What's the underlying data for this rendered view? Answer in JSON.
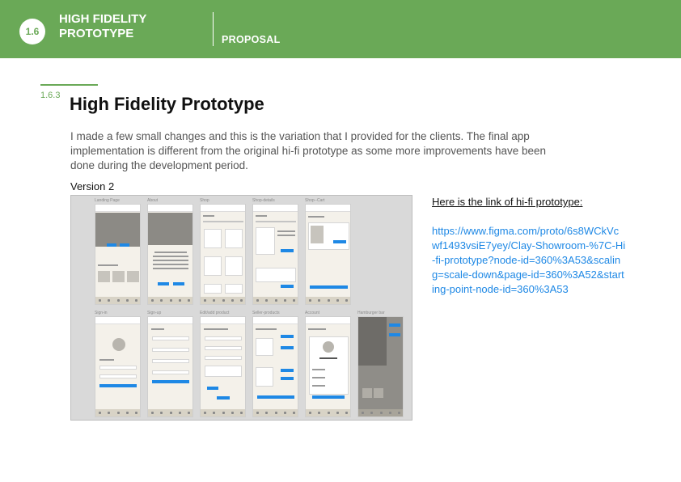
{
  "header": {
    "section_number": "1.6",
    "section_title": "HIGH FIDELITY PROTOTYPE",
    "subsection": "PROPOSAL",
    "color": "#6aa957"
  },
  "content": {
    "number": "1.6.3",
    "title": "High Fidelity Prototype",
    "intro": "I made a few small changes and this is the variation that I provided for the clients. The final app implementation is different from the original hi-fi prototype as some more improvements have been done during the development period.",
    "version_label": "Version 2"
  },
  "prototype_screens": [
    {
      "label": "Landing Page"
    },
    {
      "label": "About"
    },
    {
      "label": "Shop"
    },
    {
      "label": "Shop-details"
    },
    {
      "label": "Shop--Cart"
    },
    {
      "label": "Sign-in"
    },
    {
      "label": "Sign-up"
    },
    {
      "label": "Edit/add product"
    },
    {
      "label": "Seller-products"
    },
    {
      "label": "Account"
    },
    {
      "label": "Hamburger bar"
    }
  ],
  "link": {
    "heading": "Here is the link of hi-fi prototype:",
    "url": "https://www.figma.com/proto/6s8WCkVcwf1493vsiE7yey/Clay-Showroom-%7C-Hi-fi-prototype?node-id=360%3A53&scaling=scale-down&page-id=360%3A52&starting-point-node-id=360%3A53",
    "color": "#1e88e5"
  }
}
